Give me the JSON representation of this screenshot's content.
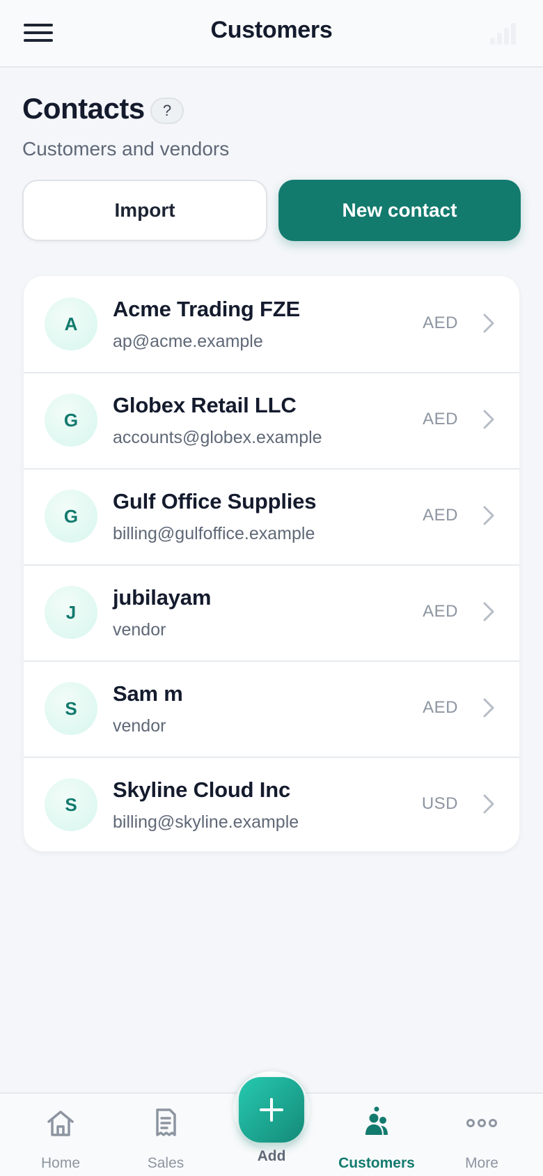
{
  "topbar": {
    "title": "Customers",
    "menu_icon": "hamburger-menu-icon",
    "status_icon": "signal-bars-icon"
  },
  "header": {
    "title": "Contacts",
    "help_label": "?",
    "subtitle": "Customers and vendors"
  },
  "actions": {
    "import_label": "Import",
    "new_contact_label": "New contact"
  },
  "contacts": [
    {
      "initial": "A",
      "name": "Acme Trading FZE",
      "sub": "ap@acme.example",
      "currency": "AED"
    },
    {
      "initial": "G",
      "name": "Globex Retail LLC",
      "sub": "accounts@globex.example",
      "currency": "AED"
    },
    {
      "initial": "G",
      "name": "Gulf Office Supplies",
      "sub": "billing@gulfoffice.example",
      "currency": "AED"
    },
    {
      "initial": "J",
      "name": "jubilayam",
      "sub": "vendor",
      "currency": "AED"
    },
    {
      "initial": "S",
      "name": "Sam m",
      "sub": "vendor",
      "currency": "AED"
    },
    {
      "initial": "S",
      "name": "Skyline Cloud Inc",
      "sub": "billing@skyline.example",
      "currency": "USD"
    }
  ],
  "bottom_nav": {
    "home": "Home",
    "sales": "Sales",
    "add": "Add",
    "customers": "Customers",
    "more": "More",
    "active": "customers"
  },
  "colors": {
    "brand": "#137a6e",
    "avatar_bg": "#d7f6ee",
    "fab_start": "#26c9b0",
    "fab_end": "#148a78"
  }
}
